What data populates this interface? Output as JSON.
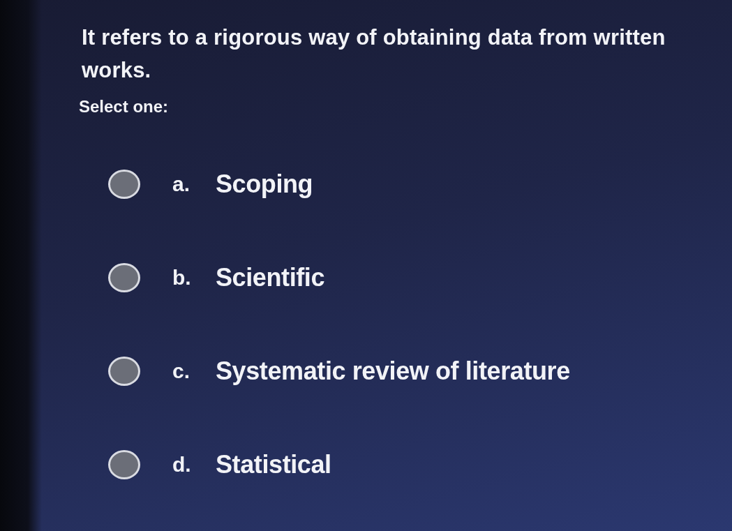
{
  "question": {
    "text": "It refers to a rigorous way of obtaining data from written works.",
    "prompt": "Select one:"
  },
  "options": [
    {
      "letter": "a.",
      "label": "Scoping",
      "selected": false
    },
    {
      "letter": "b.",
      "label": "Scientific",
      "selected": false
    },
    {
      "letter": "c.",
      "label": "Systematic review of literature",
      "selected": false
    },
    {
      "letter": "d.",
      "label": "Statistical",
      "selected": false
    }
  ]
}
